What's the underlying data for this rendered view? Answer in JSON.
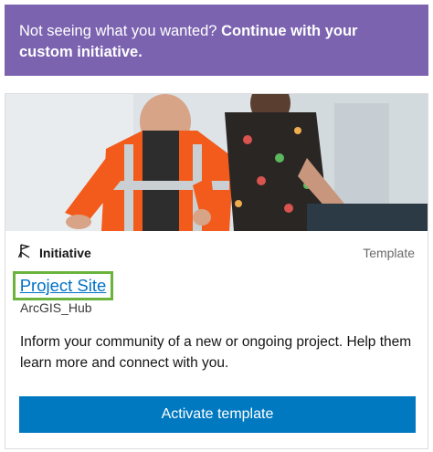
{
  "banner": {
    "prefix": "Not seeing what you wanted?",
    "emphasis": "Continue with your custom initiative."
  },
  "card": {
    "type_icon": "initiative-icon",
    "type_label": "Initiative",
    "kind_label": "Template",
    "title": "Project Site",
    "owner": "ArcGIS_Hub",
    "description": "Inform your community of a new or ongoing project. Help them learn more and connect with you.",
    "action_label": "Activate template"
  },
  "colors": {
    "banner_bg": "#7b63b0",
    "link": "#0072c6",
    "highlight_border": "#6ab43d",
    "button_bg": "#0079c1"
  }
}
